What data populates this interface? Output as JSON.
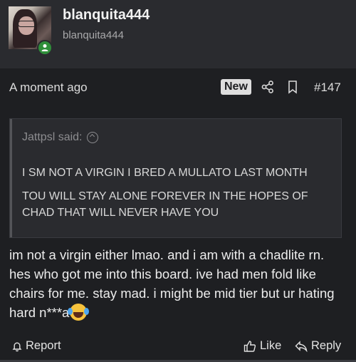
{
  "author": {
    "username": "blanquita444",
    "user_title": "blanquita444",
    "online_status_icon": "online-person-icon"
  },
  "post": {
    "timestamp": "A moment ago",
    "new_badge": "New",
    "post_number": "#147",
    "share_icon": "share-icon",
    "bookmark_icon": "bookmark-icon"
  },
  "quote": {
    "author_line": "Jattpsl said:",
    "lines": [
      "I SM NOT A VIRGIN I BRED A MULLATO LAST MONTH",
      "TOU WILL STAY ALONE FOREVER IN THE HOPES OF CHAD THAT WILL NEVER HAVE YOU"
    ]
  },
  "message": {
    "text": "im not a virgin either lmao. and i am with a chadlite rn. hes who got me into this board. ive had men fold like chairs for me. stay mad. i might be mid tier but ur hating hard n***a",
    "emoji": "tears-of-joy-emoji"
  },
  "actions": {
    "report": "Report",
    "like": "Like",
    "reply": "Reply"
  },
  "colors": {
    "background": "#1e1f22",
    "header_background": "#2a2b2f",
    "online_green": "#2f8f3a"
  }
}
